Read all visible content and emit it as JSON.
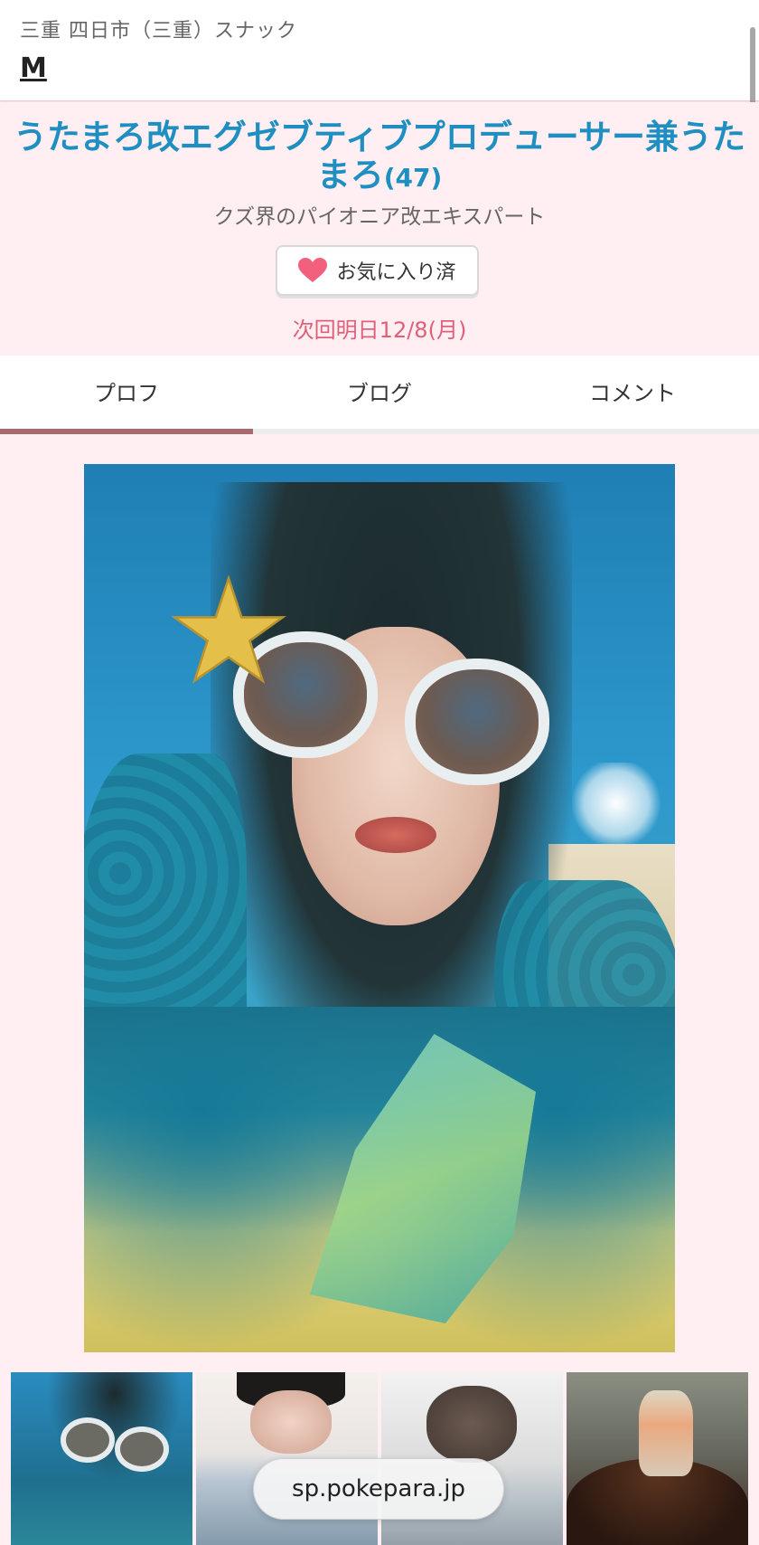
{
  "header": {
    "area": "三重 四日市（三重）スナック",
    "shop_name": "M"
  },
  "profile": {
    "name": "うたまろ改エグゼブティブプロデューサー兼うたまろ",
    "age": "(47)",
    "catchphrase": "クズ界のパイオニア改エキスパート",
    "favorite_label": "お気に入り済",
    "next_schedule": "次回明日12/8(月)"
  },
  "tabs": [
    {
      "label": "プロフ",
      "active": true
    },
    {
      "label": "ブログ",
      "active": false
    },
    {
      "label": "コメント",
      "active": false
    }
  ],
  "browser": {
    "url": "sp.pokepara.jp"
  },
  "colors": {
    "name": "#1e8fc0",
    "next_schedule": "#e0607a",
    "heart": "#f2607e",
    "tab_active": "#a76a6e",
    "background": "#ffeff3"
  },
  "icons": {
    "favorite": "heart-icon"
  }
}
